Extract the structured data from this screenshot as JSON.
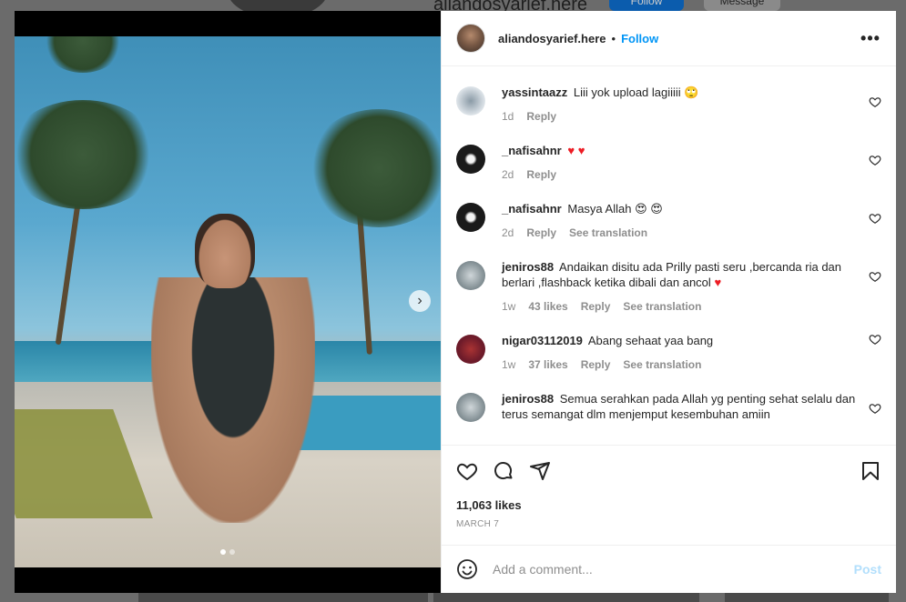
{
  "background": {
    "username": "aliandosyarief.here",
    "follow_label": "Follow",
    "message_label": "Message"
  },
  "post": {
    "username": "aliandosyarief.here",
    "bullet": "•",
    "follow_label": "Follow",
    "more_label": "•••",
    "media": {
      "slide_count": 2,
      "active_slide": 1,
      "next_glyph": "›"
    },
    "likes": "11,063 likes",
    "date": "MARCH 7",
    "comment_placeholder": "Add a comment...",
    "post_label": "Post"
  },
  "comments": [
    {
      "user": "yassintaazz",
      "text": "Liii yok upload lagiiiii",
      "emoji": "🙄",
      "time": "1d",
      "likes": "",
      "reply": "Reply",
      "translate": "",
      "avatar_color": "#c9d2d9"
    },
    {
      "user": "_nafisahnr",
      "text": "",
      "emoji": "♥ ♥",
      "time": "2d",
      "likes": "",
      "reply": "Reply",
      "translate": "",
      "avatar_color": "#1a1a1a"
    },
    {
      "user": "_nafisahnr",
      "text": "Masya Allah",
      "emoji": "😍 😍",
      "time": "2d",
      "likes": "",
      "reply": "Reply",
      "translate": "See translation",
      "avatar_color": "#1a1a1a"
    },
    {
      "user": "jeniros88",
      "text": "Andaikan disitu ada Prilly pasti seru ,bercanda ria dan berlari ,flashback ketika dibali dan ancol",
      "emoji": "♥",
      "time": "1w",
      "likes": "43 likes",
      "reply": "Reply",
      "translate": "See translation",
      "avatar_color": "#7d8a8f"
    },
    {
      "user": "nigar03112019",
      "text": "Abang sehaat yaa bang",
      "emoji": "",
      "time": "1w",
      "likes": "37 likes",
      "reply": "Reply",
      "translate": "See translation",
      "avatar_color": "#6d1b2a"
    },
    {
      "user": "jeniros88",
      "text": "Semua serahkan pada Allah yg penting sehat selalu dan terus semangat dlm menjemput kesembuhan amiin",
      "emoji": "",
      "time": "",
      "likes": "",
      "reply": "",
      "translate": "",
      "avatar_color": "#7d8a8f"
    }
  ],
  "icons": {
    "like": "heart-icon",
    "comment": "comment-icon",
    "share": "paper-plane-icon",
    "save": "bookmark-icon",
    "emoji": "smiley-icon"
  },
  "colors": {
    "accent": "#0095f6",
    "post_disabled": "#b2dffc",
    "heart_red": "#ed1c24"
  }
}
